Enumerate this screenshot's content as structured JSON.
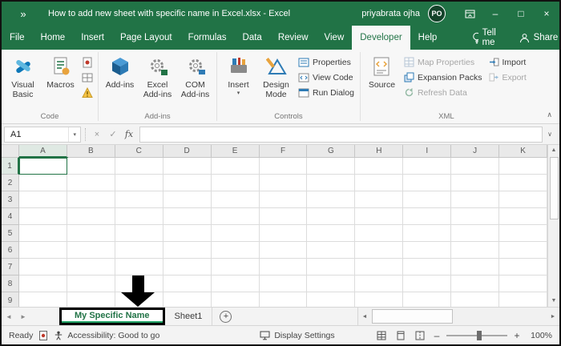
{
  "icons": {
    "qat": "»",
    "dropdown": "▾",
    "minimize": "–",
    "maximize": "□",
    "close": "×",
    "collapse_ribbon": "∧",
    "formula_expand": "∨",
    "cancel": "×",
    "enter": "✓",
    "fx": "fx",
    "scroll_up": "▲",
    "scroll_down": "▼",
    "scroll_left": "◄",
    "scroll_right": "►",
    "nav_left": "◄",
    "nav_right": "►",
    "new_sheet": "+",
    "zoom_out": "–",
    "zoom_in": "+"
  },
  "titlebar": {
    "title": "How to add new sheet with specific name in Excel.xlsx - Excel",
    "user_name": "priyabrata ojha",
    "user_initials": "PO"
  },
  "ribbon_tabs": {
    "file": "File",
    "home": "Home",
    "insert": "Insert",
    "page_layout": "Page Layout",
    "formulas": "Formulas",
    "data": "Data",
    "review": "Review",
    "view": "View",
    "developer": "Developer",
    "help": "Help",
    "tell_me": "Tell me",
    "share": "Share"
  },
  "ribbon": {
    "code": {
      "group_label": "Code",
      "visual_basic": "Visual Basic",
      "macros": "Macros"
    },
    "addins": {
      "group_label": "Add-ins",
      "add_ins": "Add-ins",
      "excel_add_ins": "Excel Add-ins",
      "com_add_ins": "COM Add-ins"
    },
    "controls": {
      "group_label": "Controls",
      "insert": "Insert",
      "design_mode": "Design Mode",
      "properties": "Properties",
      "view_code": "View Code",
      "run_dialog": "Run Dialog"
    },
    "xml": {
      "group_label": "XML",
      "source": "Source",
      "map_properties": "Map Properties",
      "expansion_packs": "Expansion Packs",
      "refresh_data": "Refresh Data",
      "import": "Import",
      "export": "Export"
    }
  },
  "formula_bar": {
    "name_box": "A1"
  },
  "grid": {
    "columns": [
      "A",
      "B",
      "C",
      "D",
      "E",
      "F",
      "G",
      "H",
      "I",
      "J",
      "K"
    ],
    "rows": [
      "1",
      "2",
      "3",
      "4",
      "5",
      "6",
      "7",
      "8",
      "9"
    ],
    "selected_cell": "A1"
  },
  "sheet_bar": {
    "active_sheet": "My Specific Name",
    "other_sheet": "Sheet1"
  },
  "status_bar": {
    "ready": "Ready",
    "accessibility": "Accessibility: Good to go",
    "display_settings": "Display Settings",
    "zoom_level": "100%"
  },
  "colors": {
    "excel_green": "#217346",
    "active_sheet_underline": "#21a366",
    "annotation_black": "#000000"
  }
}
